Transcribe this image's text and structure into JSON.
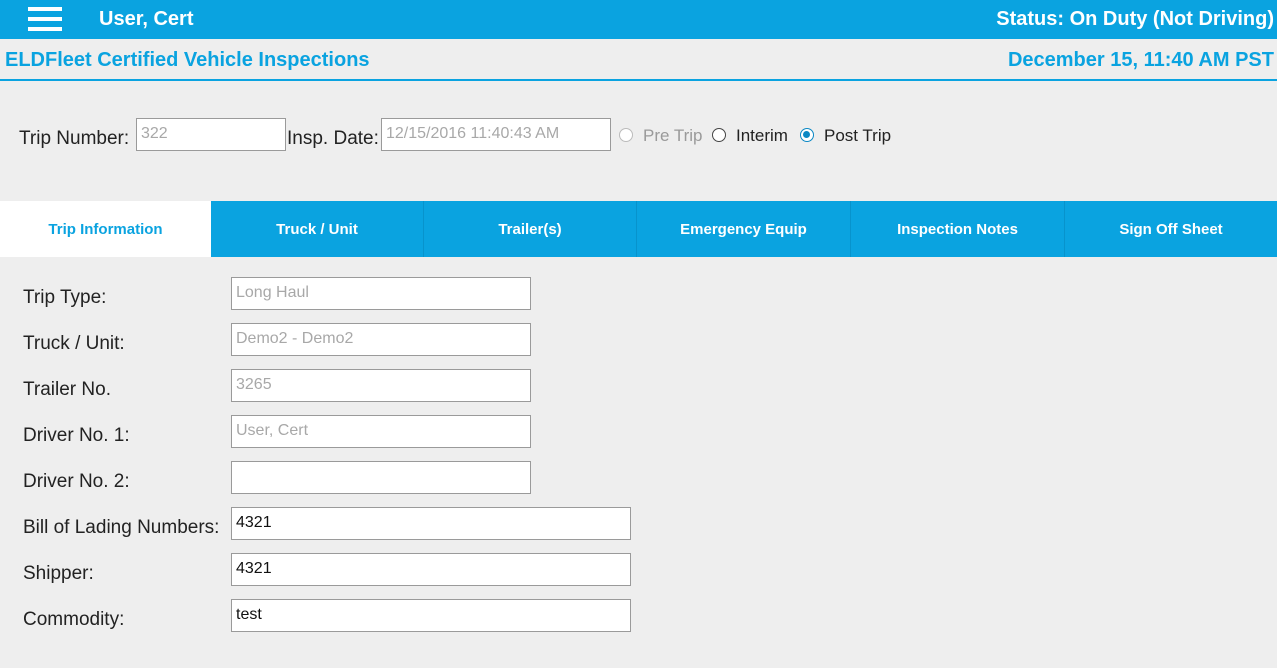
{
  "header": {
    "user_name": "User, Cert",
    "status": "Status: On Duty (Not Driving)"
  },
  "subheader": {
    "title": "ELDFleet Certified Vehicle Inspections",
    "datetime": "December 15, 11:40 AM PST"
  },
  "trip": {
    "trip_number_label": "Trip Number:",
    "trip_number_value": "322",
    "insp_date_label": "Insp. Date:",
    "insp_date_value": "12/15/2016 11:40:43 AM",
    "inspection_types": [
      {
        "label": "Pre Trip",
        "state": "disabled"
      },
      {
        "label": "Interim",
        "state": "unchecked"
      },
      {
        "label": "Post Trip",
        "state": "checked"
      }
    ]
  },
  "tabs": [
    {
      "label": "Trip Information",
      "active": true
    },
    {
      "label": "Truck / Unit",
      "active": false
    },
    {
      "label": "Trailer(s)",
      "active": false
    },
    {
      "label": "Emergency Equip",
      "active": false
    },
    {
      "label": "Inspection Notes",
      "active": false
    },
    {
      "label": "Sign Off Sheet",
      "active": false
    }
  ],
  "form": {
    "trip_type_label": "Trip Type:",
    "trip_type_value": "Long Haul",
    "truck_unit_label": "Truck / Unit:",
    "truck_unit_value": "Demo2 - Demo2",
    "trailer_no_label": "Trailer No.",
    "trailer_no_value": "3265",
    "driver1_label": "Driver No. 1:",
    "driver1_value": "User, Cert",
    "driver2_label": "Driver No. 2:",
    "driver2_value": "",
    "bol_label": "Bill of Lading Numbers:",
    "bol_value": "4321",
    "shipper_label": "Shipper:",
    "shipper_value": "4321",
    "commodity_label": "Commodity:",
    "commodity_value": "test"
  },
  "colors": {
    "accent": "#0aa3e0",
    "radio_checked": "#0b88c4"
  }
}
